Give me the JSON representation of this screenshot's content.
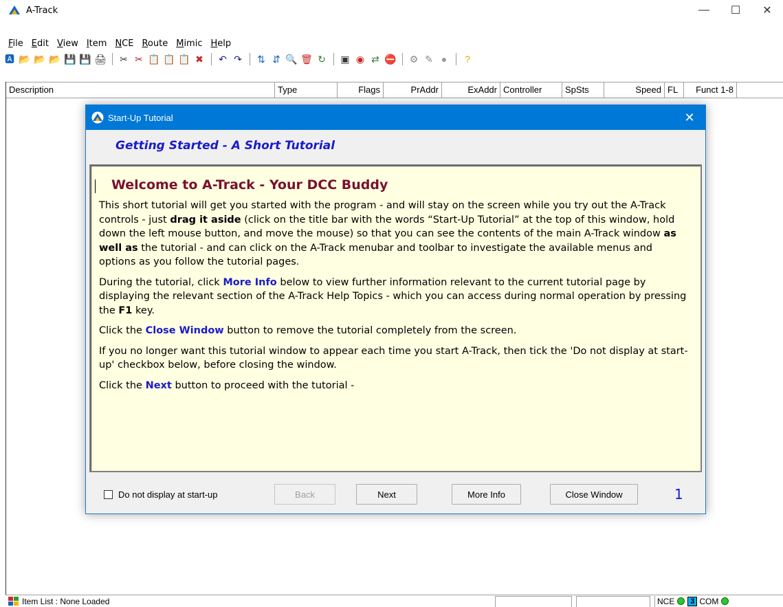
{
  "window": {
    "title": "A-Track",
    "minimize": "—",
    "maximize": "☐",
    "close": "✕"
  },
  "menu": [
    {
      "u": "F",
      "rest": "ile"
    },
    {
      "u": "E",
      "rest": "dit"
    },
    {
      "u": "V",
      "rest": "iew"
    },
    {
      "u": "I",
      "rest": "tem"
    },
    {
      "u": "N",
      "rest": "CE"
    },
    {
      "u": "R",
      "rest": "oute"
    },
    {
      "u": "M",
      "rest": "imic"
    },
    {
      "u": "H",
      "rest": "elp"
    }
  ],
  "toolbar": {
    "group1": [
      {
        "icon": "new-icon",
        "glyph": "🅰"
      },
      {
        "icon": "open-icon",
        "glyph": "📂"
      },
      {
        "icon": "open-recent-icon",
        "glyph": "📂"
      },
      {
        "icon": "import-icon",
        "glyph": "📂"
      },
      {
        "icon": "save-icon",
        "glyph": "💾"
      },
      {
        "icon": "save-as-icon",
        "glyph": "💾"
      },
      {
        "icon": "print-icon",
        "glyph": "🖨"
      }
    ],
    "group2": [
      {
        "icon": "cut-icon",
        "glyph": "✂"
      },
      {
        "icon": "cut-item-icon",
        "glyph": "✂"
      },
      {
        "icon": "copy-icon",
        "glyph": "📋"
      },
      {
        "icon": "copy-item-icon",
        "glyph": "📋"
      },
      {
        "icon": "paste-icon",
        "glyph": "📋"
      },
      {
        "icon": "delete-icon",
        "glyph": "✖"
      }
    ],
    "group3": [
      {
        "icon": "undo-icon",
        "glyph": "↶"
      },
      {
        "icon": "redo-icon",
        "glyph": "↷"
      }
    ],
    "group4": [
      {
        "icon": "sort-icon",
        "glyph": "⇅"
      },
      {
        "icon": "sort-alt-icon",
        "glyph": "⇵"
      },
      {
        "icon": "find-icon",
        "glyph": "🔍"
      },
      {
        "icon": "trash-icon",
        "glyph": "🗑"
      },
      {
        "icon": "refresh-icon",
        "glyph": "↻"
      }
    ],
    "group5": [
      {
        "icon": "properties-icon",
        "glyph": "▣"
      },
      {
        "icon": "target-icon",
        "glyph": "◉"
      },
      {
        "icon": "route-icon",
        "glyph": "⇄"
      },
      {
        "icon": "stop-icon",
        "glyph": "⛔"
      }
    ],
    "group6": [
      {
        "icon": "throttle-icon",
        "glyph": "⚙"
      },
      {
        "icon": "program-icon",
        "glyph": "✎"
      },
      {
        "icon": "record-icon",
        "glyph": "●"
      }
    ],
    "group7": [
      {
        "icon": "help-icon",
        "glyph": "?"
      }
    ]
  },
  "columns": [
    {
      "label": "Description",
      "width": 391,
      "align": "left"
    },
    {
      "label": "Type",
      "width": 91,
      "align": "left"
    },
    {
      "label": "Flags",
      "width": 67,
      "align": "right"
    },
    {
      "label": "PrAddr",
      "width": 85,
      "align": "right"
    },
    {
      "label": "ExAddr",
      "width": 85,
      "align": "right"
    },
    {
      "label": "Controller",
      "width": 90,
      "align": "left"
    },
    {
      "label": "SpSts",
      "width": 61,
      "align": "left"
    },
    {
      "label": "Speed",
      "width": 88,
      "align": "right"
    },
    {
      "label": "FL",
      "width": 28,
      "align": "left"
    },
    {
      "label": "Funct 1-8",
      "width": 77,
      "align": "right"
    }
  ],
  "status": {
    "item_list": "Item List : None Loaded",
    "nce": "NCE",
    "com_num": "3",
    "com": "COM"
  },
  "dialog": {
    "title": "Start-Up Tutorial",
    "close": "✕",
    "subhead": "Getting Started  -  A Short Tutorial",
    "heading": "Welcome to A-Track - Your DCC Buddy",
    "p1_a": "This short tutorial will get you started with the program - and will stay on the screen while you try out the A-Track controls - just ",
    "p1_b": "drag it aside",
    "p1_c": " (click on the title bar with the words “Start-Up Tutorial” at the top of this window, hold down the left mouse button, and move the mouse) so that you can see the contents of the main A-Track window ",
    "p1_d": "as well as",
    "p1_e": " the tutorial - and can click on the A-Track menubar and toolbar to investigate the available menus and options as you follow the tutorial pages.",
    "p2_a": "During the tutorial, click ",
    "p2_b": "More Info",
    "p2_c": " below to view further information relevant to the current tutorial page by displaying the relevant section of the A-Track Help Topics - which you can access during normal operation by pressing the ",
    "p2_d": "F1",
    "p2_e": " key.",
    "p3_a": "Click the ",
    "p3_b": "Close Window",
    "p3_c": " button to remove the tutorial completely from the screen.",
    "p4": "If you no longer want this tutorial window to appear each time you start A-Track, then tick the 'Do not display at start-up' checkbox below, before closing the window.",
    "p5_a": "Click the ",
    "p5_b": "Next",
    "p5_c": " button to proceed with the tutorial -",
    "checkbox_label": "Do not display at start-up",
    "back": "Back",
    "next": "Next",
    "more_info": "More Info",
    "close_window": "Close Window",
    "page": "1"
  }
}
